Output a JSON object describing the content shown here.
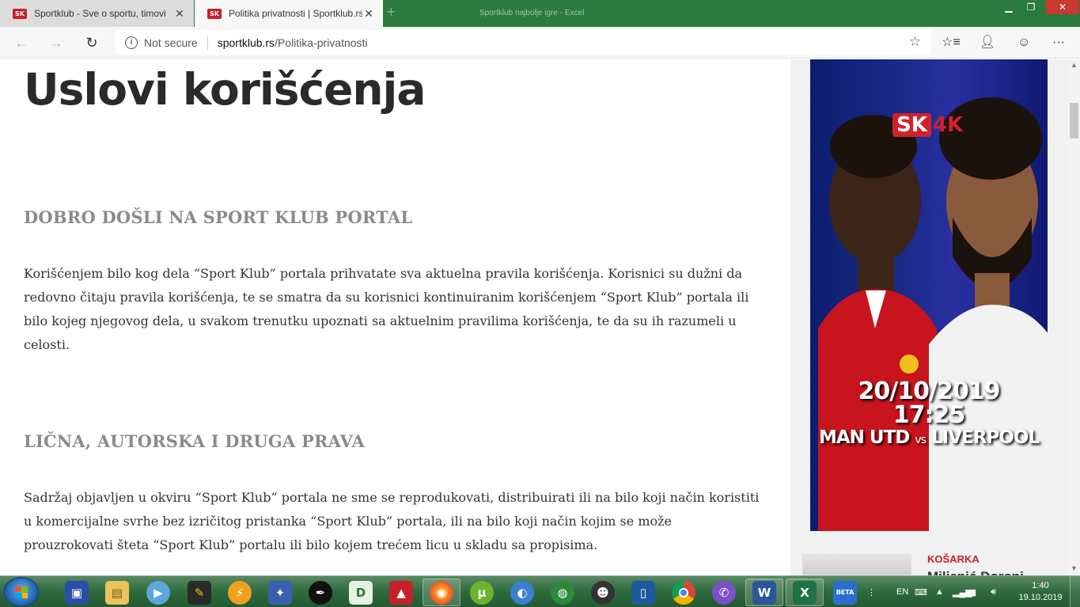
{
  "browser": {
    "window_title": "Sportklub najbolje igre - Excel",
    "tabs": [
      {
        "title": "Sportklub - Sve o sportu, timovi",
        "favicon": "SK",
        "active": false
      },
      {
        "title": "Politika privatnosti | Sportklub.rs",
        "favicon": "SK",
        "active": true
      }
    ],
    "new_tab": "+",
    "address": {
      "security": "Not secure",
      "host": "sportklub.rs",
      "path": "/Politika-privatnosti"
    },
    "icons": {
      "back": "back-arrow-icon",
      "forward": "forward-arrow-icon",
      "refresh": "refresh-icon",
      "favorite": "star-icon",
      "favorites_list": "favorites-list-icon",
      "profile": "person-icon",
      "feedback": "smiley-icon",
      "more": "more-icon"
    }
  },
  "page": {
    "title": "Uslovi korišćenja",
    "sections": [
      {
        "heading": "DOBRO DOŠLI NA SPORT KLUB PORTAL",
        "lines": [
          "Korišćenjem bilo kog dela “Sport Klub” portala prihvatate sva aktuelna pravila korišćenja. Korisnici su dužni da",
          "redovno čitaju pravila korišćenja, te se smatra da su korisnici kontinuiranim korišćenjem “Sport Klub” portala ili",
          "bilo kojeg njegovog dela, u svakom trenutku upoznati sa aktuelnim pravilima korišćenja, te da su ih razumeli u",
          "celosti."
        ]
      },
      {
        "heading": "LIČNA, AUTORSKA I DRUGA PRAVA",
        "lines": [
          "Sadržaj objavljen u okviru “Sport Klub” portala ne sme se reprodukovati, distribuirati ili na bilo koji način koristiti",
          "u komercijalne svrhe bez izričitog pristanka “Sport Klub” portala, ili na bilo koji način kojim se može",
          "prouzrokovati šteta “Sport Klub” portalu ili bilo kojem trećem licu u skladu sa propisima."
        ]
      }
    ]
  },
  "sidebar": {
    "ad": {
      "logo_sk": "SK",
      "logo_4k": "4K",
      "date": "20/10/2019",
      "time": "17:25",
      "home": "MAN UTD",
      "vs": "vs",
      "away": "LIVERPOOL"
    },
    "news": {
      "category": "KOŠARKA",
      "headline": "Miljenić Doroni"
    }
  },
  "taskbar": {
    "items": [
      "floppy-icon",
      "file-explorer-icon",
      "media-player-icon",
      "scribble-app-icon",
      "lightning-app-icon",
      "game-icon",
      "inkscape-icon",
      "d-app-icon",
      "acrobat-icon",
      "firefox-icon",
      "utorrent-icon",
      "vpn-icon",
      "globe-game-icon",
      "robot-app-icon",
      "window-app-icon",
      "chrome-icon",
      "viber-icon",
      "word-icon",
      "excel-icon",
      "beta-app-icon"
    ],
    "d_label": "D",
    "word_label": "W",
    "excel_label": "X",
    "beta_label": "BETA",
    "language": "EN",
    "time": "1:40",
    "date": "19.10.2019"
  }
}
